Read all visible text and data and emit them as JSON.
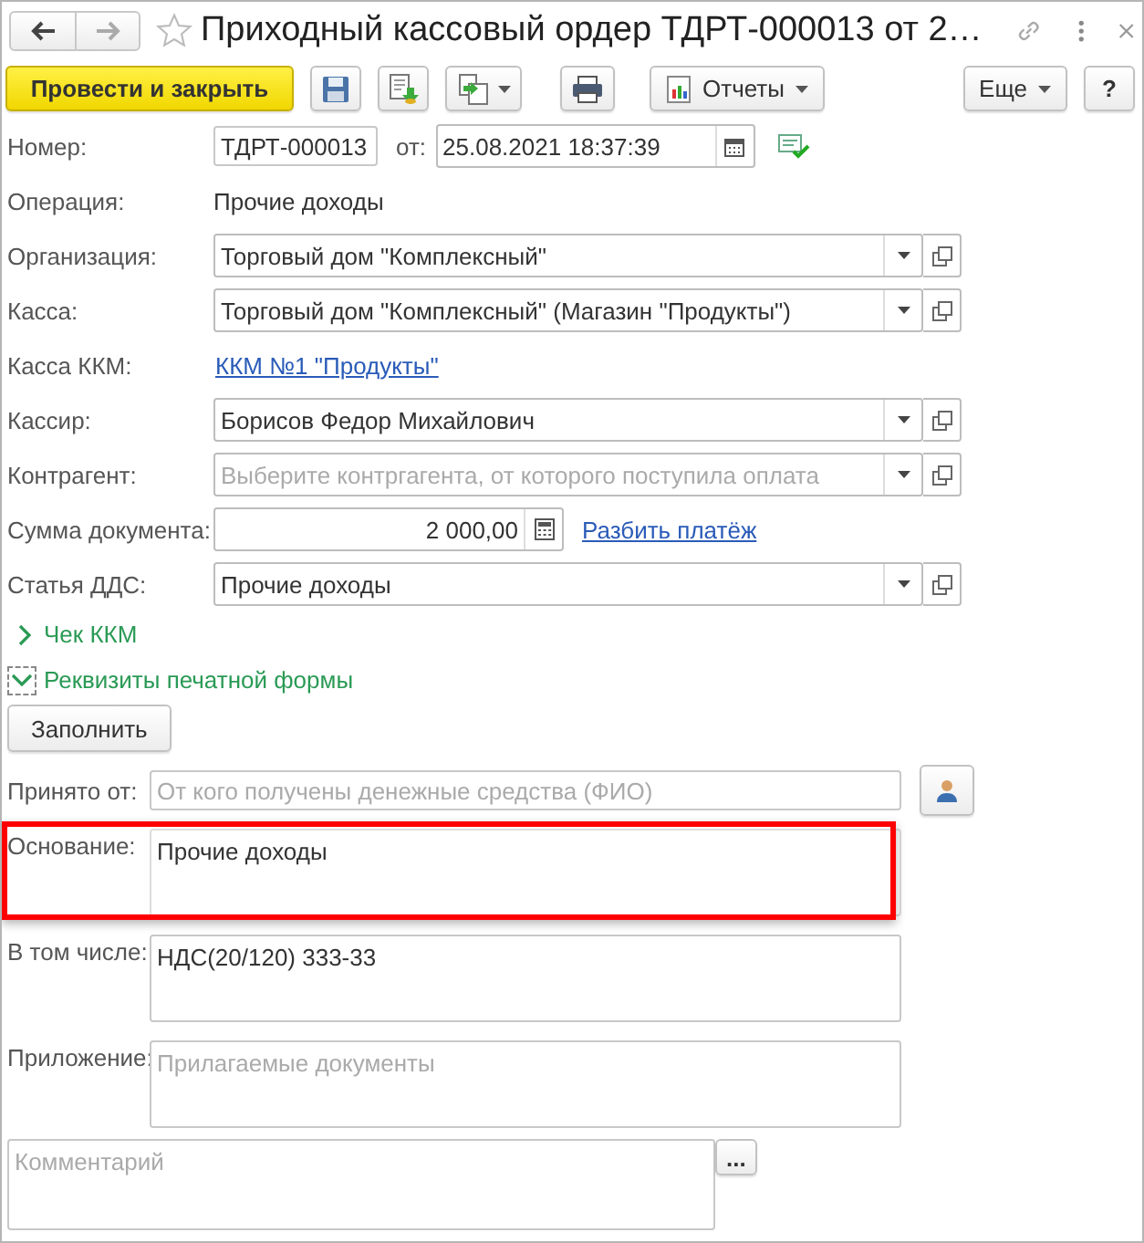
{
  "window": {
    "title": "Приходный кассовый ордер ТДРТ-000013 от 2…"
  },
  "toolbar": {
    "primary": "Провести и закрыть",
    "reports": "Отчеты",
    "more": "Еще",
    "help": "?"
  },
  "number": {
    "label": "Номер:",
    "value": "ТДРТ-000013",
    "date_label": "от:",
    "date": "25.08.2021 18:37:39"
  },
  "fields": [
    {
      "kind": "text",
      "label": "Операция:",
      "value": "Прочие доходы"
    },
    {
      "kind": "select",
      "label": "Организация:",
      "value": "Торговый дом \"Комплексный\""
    },
    {
      "kind": "select",
      "label": "Касса:",
      "value": "Торговый дом \"Комплексный\" (Магазин \"Продукты\")"
    },
    {
      "kind": "link",
      "label": "Касса ККМ:",
      "value": "ККМ №1 \"Продукты\""
    },
    {
      "kind": "select",
      "label": "Кассир:",
      "value": "Борисов Федор Михайлович"
    },
    {
      "kind": "select",
      "label": "Контрагент:",
      "placeholder": "Выберите контргагента, от которого поступила оплата"
    },
    {
      "kind": "amount",
      "label": "Сумма документа:",
      "value": "2 000,00",
      "link": "Разбить платёж"
    },
    {
      "kind": "select",
      "label": "Статья ДДС:",
      "value": "Прочие доходы"
    }
  ],
  "groups": [
    {
      "label": "Чек ККМ",
      "expanded": false
    },
    {
      "label": "Реквизиты печатной формы",
      "expanded": true
    }
  ],
  "fill_button": "Заполнить",
  "received_from": {
    "label": "Принято от:",
    "placeholder": "От кого получены денежные средства (ФИО)"
  },
  "memos": [
    {
      "label": "Основание:",
      "value": "Прочие доходы",
      "highlighted": true
    },
    {
      "label": "В том числе:",
      "value": "НДС(20/120) 333-33",
      "highlighted": false
    },
    {
      "label": "Приложение:",
      "placeholder": "Прилагаемые документы",
      "highlighted": false
    }
  ],
  "comment": {
    "placeholder": "Комментарий",
    "button": "..."
  }
}
